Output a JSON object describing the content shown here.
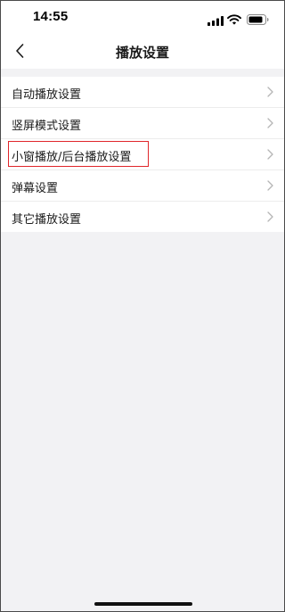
{
  "status_bar": {
    "time": "14:55",
    "icons": [
      "signal-icon",
      "wifi-icon",
      "battery-icon"
    ]
  },
  "nav": {
    "back_icon": "chevron-left-icon",
    "title": "播放设置"
  },
  "settings": {
    "items": [
      {
        "label": "自动播放设置"
      },
      {
        "label": "竖屏模式设置"
      },
      {
        "label": "小窗播放/后台播放设置",
        "highlighted": true
      },
      {
        "label": "弹幕设置"
      },
      {
        "label": "其它播放设置"
      }
    ]
  },
  "colors": {
    "background": "#f2f2f4",
    "surface": "#ffffff",
    "highlight_border": "#e0262a",
    "chevron": "#b5b5b5"
  }
}
